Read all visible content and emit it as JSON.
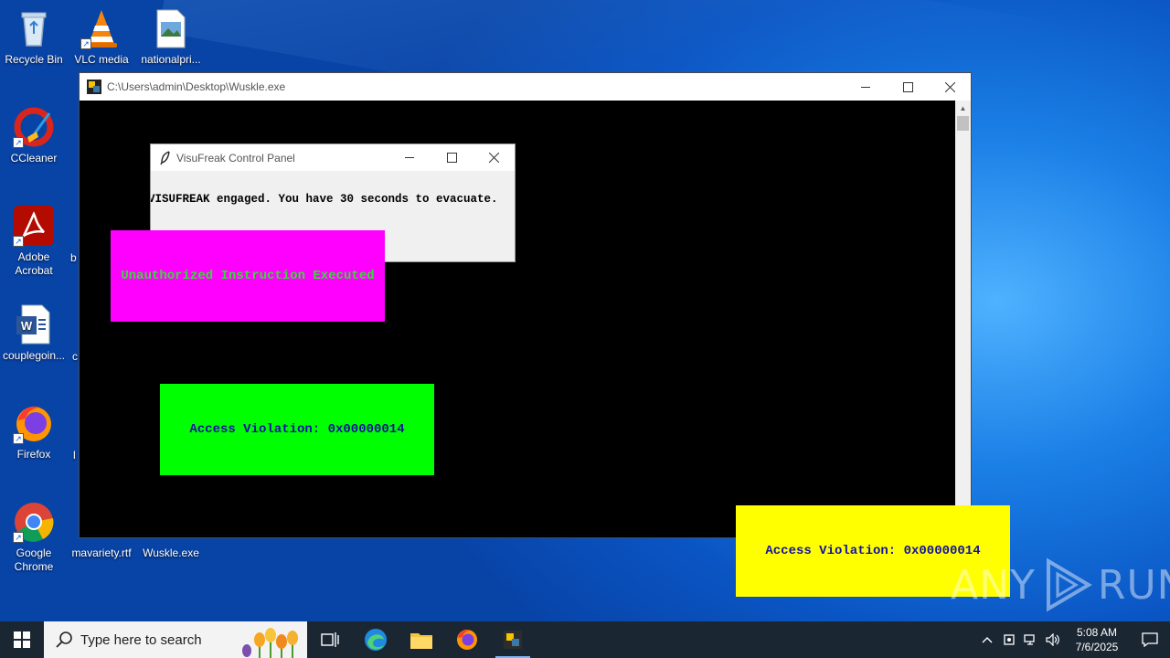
{
  "desktop": {
    "icons": [
      {
        "label": "Recycle Bin"
      },
      {
        "label": "VLC media"
      },
      {
        "label": "nationalpri..."
      },
      {
        "label": "CCleaner"
      },
      {
        "label": "Adobe Acrobat"
      },
      {
        "label": "couplegoin..."
      },
      {
        "label": "Firefox"
      },
      {
        "label": "Google Chrome"
      },
      {
        "label": "mavariety.rtf"
      },
      {
        "label": "Wuskle.exe"
      }
    ],
    "partial_labels": [
      "b",
      "c",
      "l"
    ]
  },
  "console_window": {
    "title": "C:\\Users\\admin\\Desktop\\Wuskle.exe"
  },
  "control_panel": {
    "title": "VisuFreak Control Panel",
    "message": "VISUFREAK engaged. You have 30 seconds to evacuate."
  },
  "popups": [
    {
      "text": "Unauthorized Instruction Executed",
      "bg": "#ff00ff",
      "fg": "#33dd33"
    },
    {
      "text": "Access Violation: 0x00000014",
      "bg": "#00ff00",
      "fg": "#1212a0"
    },
    {
      "text": "Access Violation: 0x00000014",
      "bg": "#ffff00",
      "fg": "#1212a0"
    }
  ],
  "watermark": {
    "left": "ANY",
    "right": "RUN"
  },
  "taskbar": {
    "search_placeholder": "Type here to search",
    "time": "5:08 AM",
    "date": "7/6/2025"
  },
  "colors": {
    "taskbar": "#1b2633",
    "accent": "#0a55c4"
  }
}
